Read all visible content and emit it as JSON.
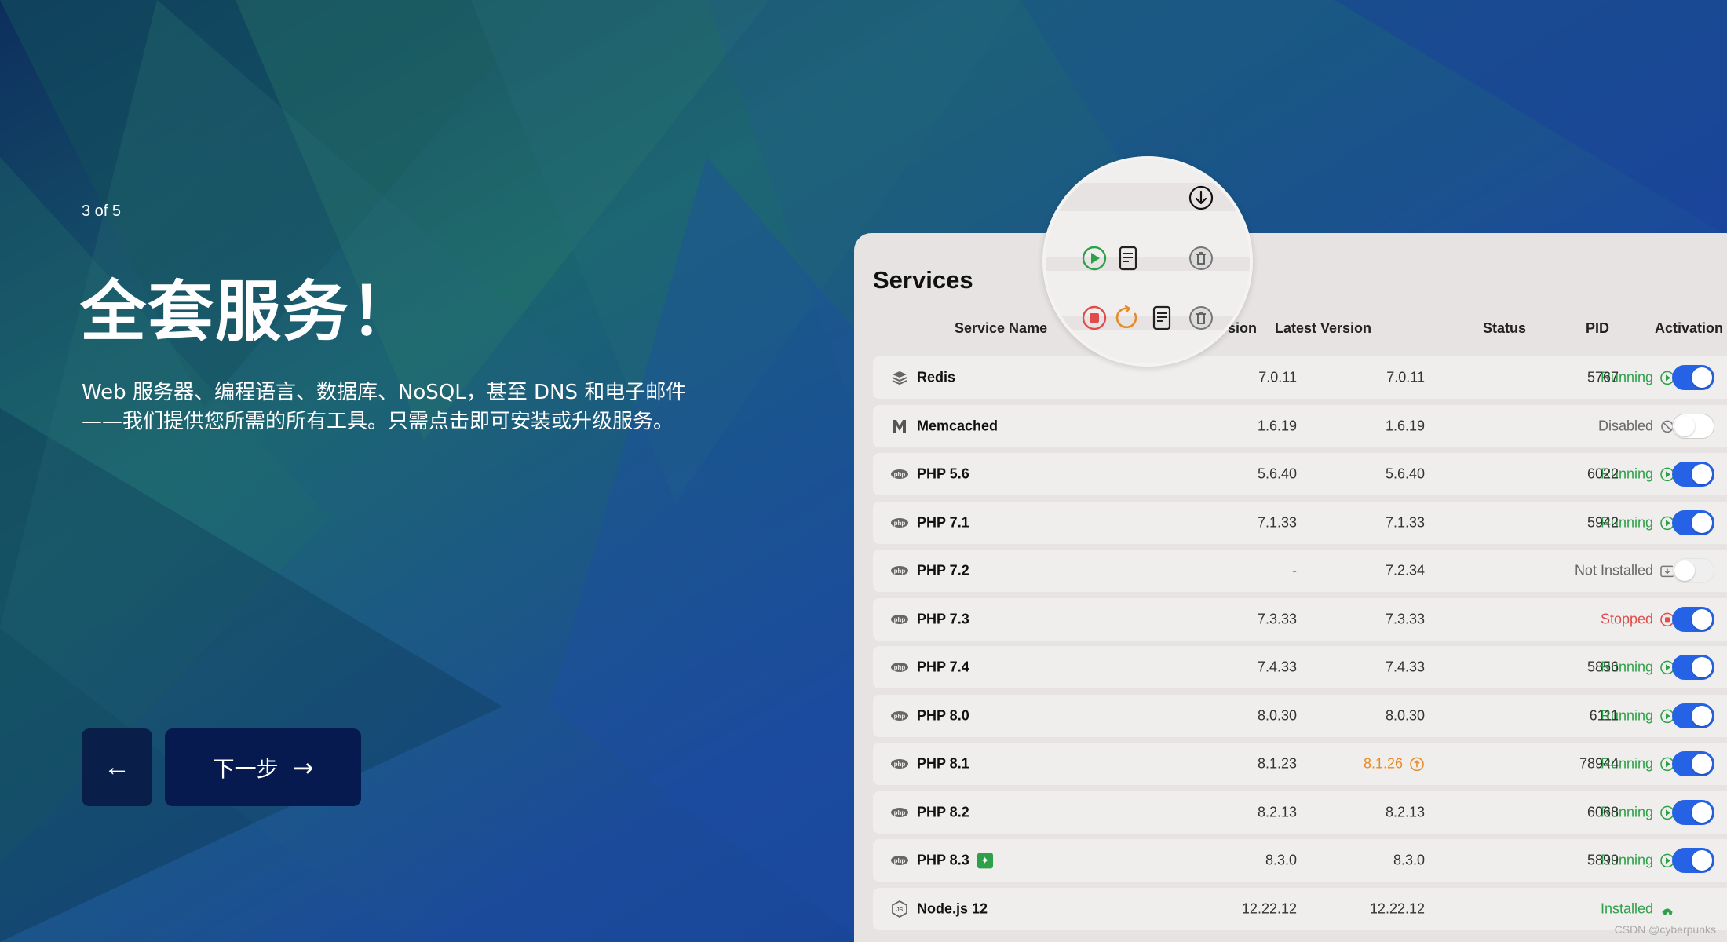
{
  "slide": {
    "counter": "3 of 5",
    "title": "全套服务！",
    "description": "Web 服务器、编程语言、数据库、NoSQL，甚至 DNS 和电子邮件——我们提供您所需的所有工具。只需点击即可安装或升级服务。",
    "back_icon": "←",
    "next_label": "下一步",
    "next_icon": "→"
  },
  "window": {
    "title": "Services",
    "columns": {
      "service_name": "Service Name",
      "version_partial": "sion",
      "latest_version": "Latest Version",
      "status": "Status",
      "pid": "PID",
      "activation": "Activation"
    },
    "rows": [
      {
        "name": "Redis",
        "icon": "stack-icon",
        "version": "7.0.11",
        "latest": "7.0.11",
        "status": "Running",
        "status_kind": "running",
        "pid": "5767",
        "active": true
      },
      {
        "name": "Memcached",
        "icon": "memcached-icon",
        "version": "1.6.19",
        "latest": "1.6.19",
        "status": "Disabled",
        "status_kind": "disabled",
        "pid": "",
        "active": false
      },
      {
        "name": "PHP 5.6",
        "icon": "php-icon",
        "version": "5.6.40",
        "latest": "5.6.40",
        "status": "Running",
        "status_kind": "running",
        "pid": "6022",
        "active": true
      },
      {
        "name": "PHP 7.1",
        "icon": "php-icon",
        "version": "7.1.33",
        "latest": "7.1.33",
        "status": "Running",
        "status_kind": "running",
        "pid": "5942",
        "active": true
      },
      {
        "name": "PHP 7.2",
        "icon": "php-icon",
        "version": "-",
        "latest": "7.2.34",
        "status": "Not Installed",
        "status_kind": "not-installed",
        "pid": "",
        "active": null
      },
      {
        "name": "PHP 7.3",
        "icon": "php-icon",
        "version": "7.3.33",
        "latest": "7.3.33",
        "status": "Stopped",
        "status_kind": "stopped",
        "pid": "",
        "active": true
      },
      {
        "name": "PHP 7.4",
        "icon": "php-icon",
        "version": "7.4.33",
        "latest": "7.4.33",
        "status": "Running",
        "status_kind": "running",
        "pid": "5856",
        "active": true
      },
      {
        "name": "PHP 8.0",
        "icon": "php-icon",
        "version": "8.0.30",
        "latest": "8.0.30",
        "status": "Running",
        "status_kind": "running",
        "pid": "6111",
        "active": true
      },
      {
        "name": "PHP 8.1",
        "icon": "php-icon",
        "version": "8.1.23",
        "latest": "8.1.26",
        "latest_update": true,
        "status": "Running",
        "status_kind": "running",
        "pid": "78944",
        "active": true
      },
      {
        "name": "PHP 8.2",
        "icon": "php-icon",
        "version": "8.2.13",
        "latest": "8.2.13",
        "status": "Running",
        "status_kind": "running",
        "pid": "6068",
        "active": true
      },
      {
        "name": "PHP 8.3",
        "icon": "php-icon",
        "new_badge": true,
        "version": "8.3.0",
        "latest": "8.3.0",
        "status": "Running",
        "status_kind": "running",
        "pid": "5899",
        "active": true
      },
      {
        "name": "Node.js 12",
        "icon": "nodejs-icon",
        "version": "12.22.12",
        "latest": "12.22.12",
        "status": "Installed",
        "status_kind": "installed",
        "pid": "",
        "active": null
      }
    ]
  },
  "magnifier": {
    "icons": [
      "download-icon",
      "play-icon",
      "log-icon",
      "trash-icon",
      "stop-icon",
      "restart-icon",
      "log-icon",
      "trash-icon"
    ]
  },
  "colors": {
    "running": "#2fa04a",
    "stopped": "#e24b4b",
    "update": "#e98a27",
    "toggle_on": "#2562e6",
    "muted": "#666666"
  },
  "watermark": "CSDN @cyberpunks"
}
